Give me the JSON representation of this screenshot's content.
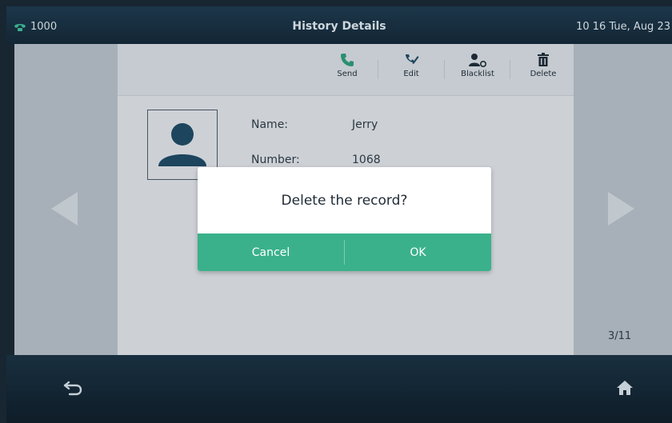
{
  "status_bar": {
    "line": "1000",
    "title": "History Details",
    "datetime": "10 16 Tue, Aug 23"
  },
  "toolbar": {
    "send_label": "Send",
    "edit_label": "Edit",
    "blacklist_label": "Blacklist",
    "delete_label": "Delete"
  },
  "contact": {
    "name_label": "Name:",
    "name_value": "Jerry",
    "number_label": "Number:",
    "number_value": "1068"
  },
  "page_indicator": "3/11",
  "dialog": {
    "message": "Delete the record?",
    "cancel_label": "Cancel",
    "ok_label": "OK"
  },
  "colors": {
    "accent": "#3ab18b",
    "status_bar": "#1e3a4f"
  }
}
